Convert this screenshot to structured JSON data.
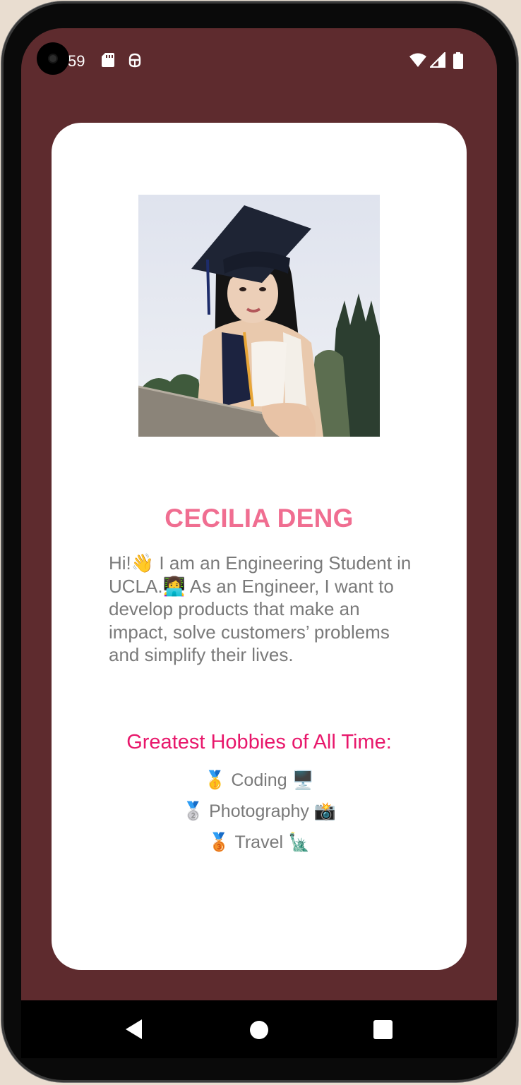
{
  "status_bar": {
    "time": "59",
    "icons": [
      "sd-card-icon",
      "android-debug-icon",
      "wifi-icon",
      "signal-icon",
      "battery-icon"
    ]
  },
  "profile": {
    "photo_description": "profile-photo",
    "name": "CECILIA DENG",
    "bio": "Hi!👋 I am an Engineering Student in UCLA.👩‍💻 As an Engineer, I want to develop products that make an impact, solve customers’ problems and simplify their lives."
  },
  "hobbies": {
    "title": "Greatest Hobbies of All Time:",
    "items": [
      {
        "medal": "🥇",
        "label": "Coding",
        "emoji": "🖥️"
      },
      {
        "medal": "🥈",
        "label": "Photography",
        "emoji": "📸"
      },
      {
        "medal": "🥉",
        "label": "Travel",
        "emoji": "🗽"
      }
    ]
  },
  "nav_bar": {
    "buttons": [
      "back-icon",
      "home-icon",
      "recents-icon"
    ]
  },
  "colors": {
    "background": "#5e2b2e",
    "card": "#ffffff",
    "name": "#f06e91",
    "hobbies_title": "#e8176b",
    "body_text": "#7a7a7a"
  }
}
